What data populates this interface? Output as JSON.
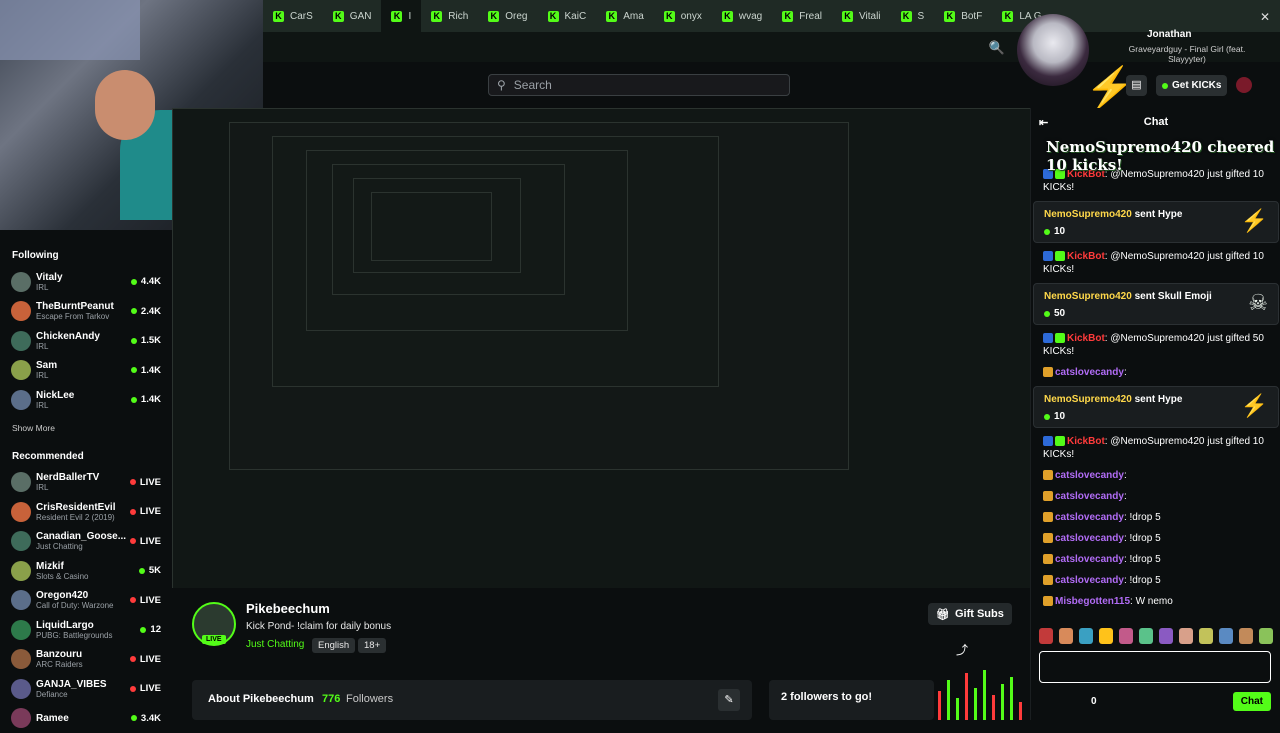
{
  "tabs": [
    {
      "label": "CarS"
    },
    {
      "label": "GAN"
    },
    {
      "label": "I"
    },
    {
      "label": "Rich"
    },
    {
      "label": "Oreg"
    },
    {
      "label": "KaiC"
    },
    {
      "label": "Ama"
    },
    {
      "label": "onyx"
    },
    {
      "label": "wvag"
    },
    {
      "label": "Freal"
    },
    {
      "label": "Vitali"
    },
    {
      "label": "S"
    },
    {
      "label": "BotF"
    },
    {
      "label": "LA G"
    }
  ],
  "search": {
    "placeholder": "Search"
  },
  "now_playing": {
    "name": "Jonathan",
    "song": "Graveyardguy - Final Girl (feat. Slayyyter)"
  },
  "header": {
    "get_kicks": "Get KICKs"
  },
  "sidebar": {
    "following_title": "Following",
    "following": [
      {
        "name": "Vitaly",
        "category": "IRL",
        "value": "4.4K"
      },
      {
        "name": "TheBurntPeanut",
        "category": "Escape From Tarkov",
        "value": "2.4K"
      },
      {
        "name": "ChickenAndy",
        "category": "IRL",
        "value": "1.5K"
      },
      {
        "name": "Sam",
        "category": "IRL",
        "value": "1.4K"
      },
      {
        "name": "NickLee",
        "category": "IRL",
        "value": "1.4K"
      }
    ],
    "show_more": "Show More",
    "recommended_title": "Recommended",
    "recommended": [
      {
        "name": "NerdBallerTV",
        "category": "IRL",
        "value": "LIVE"
      },
      {
        "name": "CrisResidentEvil",
        "category": "Resident Evil 2 (2019)",
        "value": "LIVE"
      },
      {
        "name": "Canadian_Goose...",
        "category": "Just Chatting",
        "value": "LIVE"
      },
      {
        "name": "Mizkif",
        "category": "Slots & Casino",
        "value": "5K"
      },
      {
        "name": "Oregon420",
        "category": "Call of Duty: Warzone",
        "value": "LIVE"
      },
      {
        "name": "LiquidLargo",
        "category": "PUBG: Battlegrounds",
        "value": "12"
      },
      {
        "name": "Banzouru",
        "category": "ARC Raiders",
        "value": "LIVE"
      },
      {
        "name": "GANJA_VIBES",
        "category": "Defiance",
        "value": "LIVE"
      },
      {
        "name": "Ramee",
        "category": "",
        "value": "3.4K"
      }
    ]
  },
  "channel": {
    "name": "Pikebeechum",
    "title": "Kick Pond- !claim for daily bonus",
    "category": "Just Chatting",
    "tags": [
      "English",
      "18+"
    ],
    "live": "LIVE",
    "gift_subs": "Gift Subs",
    "about": "About Pikebeechum",
    "followers_count": "776",
    "followers_label": "Followers",
    "goal": "2 followers to go!"
  },
  "chat": {
    "title": "Chat",
    "cheer_banner": "NemoSupremo420 cheered 10 kicks!",
    "messages": [
      {
        "type": "bot",
        "user": "KickBot",
        "text": ": @NemoSupremo420 just gifted 10 KICKs!"
      },
      {
        "type": "card",
        "user": "NemoSupremo420",
        "action": " sent Hype",
        "value": "10",
        "icon": "bolt"
      },
      {
        "type": "bot",
        "user": "KickBot",
        "text": ": @NemoSupremo420 just gifted 10 KICKs!"
      },
      {
        "type": "card",
        "user": "NemoSupremo420",
        "action": " sent Skull Emoji",
        "value": "50",
        "icon": "skull"
      },
      {
        "type": "bot",
        "user": "KickBot",
        "text": ": @NemoSupremo420 just gifted 50 KICKs!"
      },
      {
        "type": "user",
        "user": "catslovecandy",
        "text": ": "
      },
      {
        "type": "card",
        "user": "NemoSupremo420",
        "action": " sent Hype",
        "value": "10",
        "icon": "bolt"
      },
      {
        "type": "bot",
        "user": "KickBot",
        "text": ": @NemoSupremo420 just gifted 10 KICKs!"
      },
      {
        "type": "user",
        "user": "catslovecandy",
        "text": ": "
      },
      {
        "type": "user",
        "user": "catslovecandy",
        "text": ": "
      },
      {
        "type": "user",
        "user": "catslovecandy",
        "text": ": !drop 5"
      },
      {
        "type": "user",
        "user": "catslovecandy",
        "text": ": !drop 5"
      },
      {
        "type": "user",
        "user": "catslovecandy",
        "text": ": !drop 5"
      },
      {
        "type": "user",
        "user": "catslovecandy",
        "text": ": !drop 5"
      },
      {
        "type": "user",
        "user": "Misbegotten115",
        "text": ": W nemo"
      }
    ],
    "send": "Chat",
    "points": "0"
  },
  "colors": {
    "accent": "#53fc18",
    "bot": "#ff3b3b",
    "hype": "#ffc21a"
  }
}
